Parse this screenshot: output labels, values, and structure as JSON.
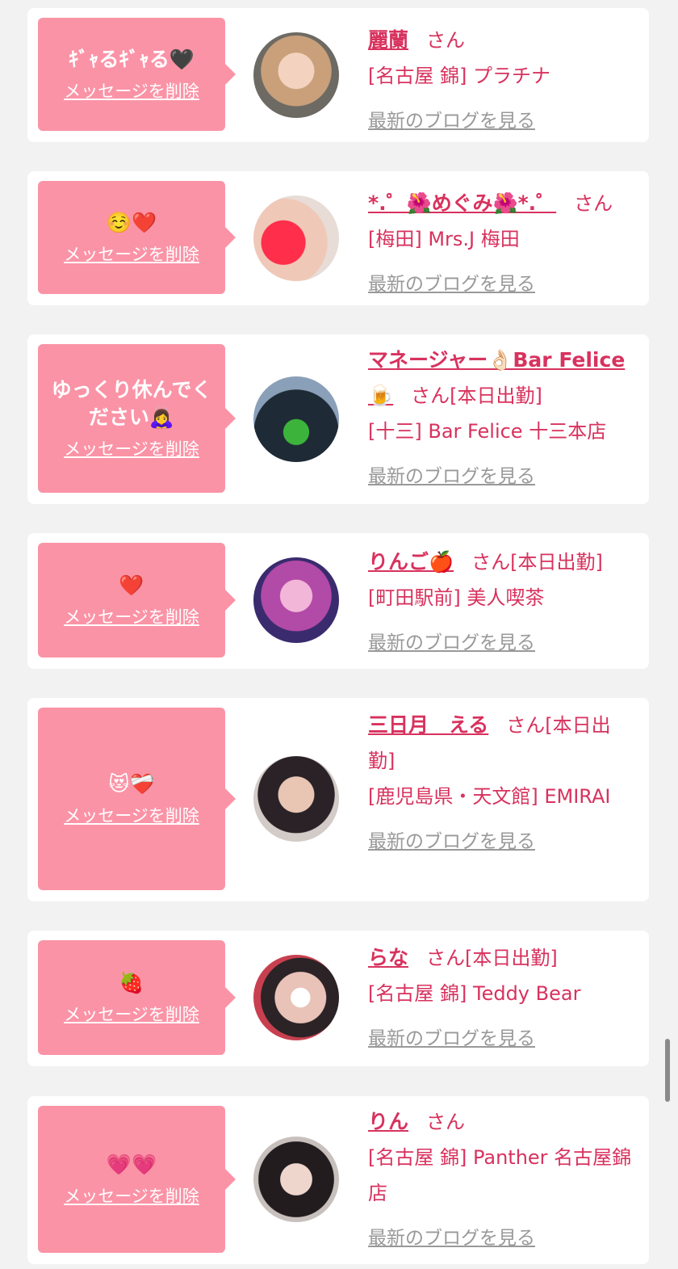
{
  "delete_label": "メッセージを削除",
  "blog_label": "最新のブログを見る",
  "honorific": "さん",
  "entries": [
    {
      "message": "ｷﾞｬるｷﾞｬる🖤",
      "name": "麗蘭",
      "status": "",
      "shop": "[名古屋 錦] プラチナ"
    },
    {
      "message": "☺️❤️",
      "name": "*.゜🌺めぐみ🌺*.゜",
      "status": "",
      "shop": "[梅田] Mrs.J 梅田"
    },
    {
      "message": "ゆっくり休んでください🙇‍♀️",
      "name": "マネージャー👌🏻Bar Felice🍺",
      "status": "[本日出勤]",
      "shop": "[十三] Bar Felice 十三本店"
    },
    {
      "message": "❤️",
      "name": "りんご🍎",
      "status": "[本日出勤]",
      "shop": "[町田駅前] 美人喫茶"
    },
    {
      "message": "😻❤️‍🩹",
      "name": "三日月　える",
      "status": "[本日出勤]",
      "shop": "[鹿児島県・天文館] EMIRAI"
    },
    {
      "message": "🍓",
      "name": "らな",
      "status": "[本日出勤]",
      "shop": "[名古屋 錦] Teddy Bear"
    },
    {
      "message": "💗💗",
      "name": "りん",
      "status": "",
      "shop": "[名古屋 錦] Panther 名古屋錦店"
    }
  ]
}
